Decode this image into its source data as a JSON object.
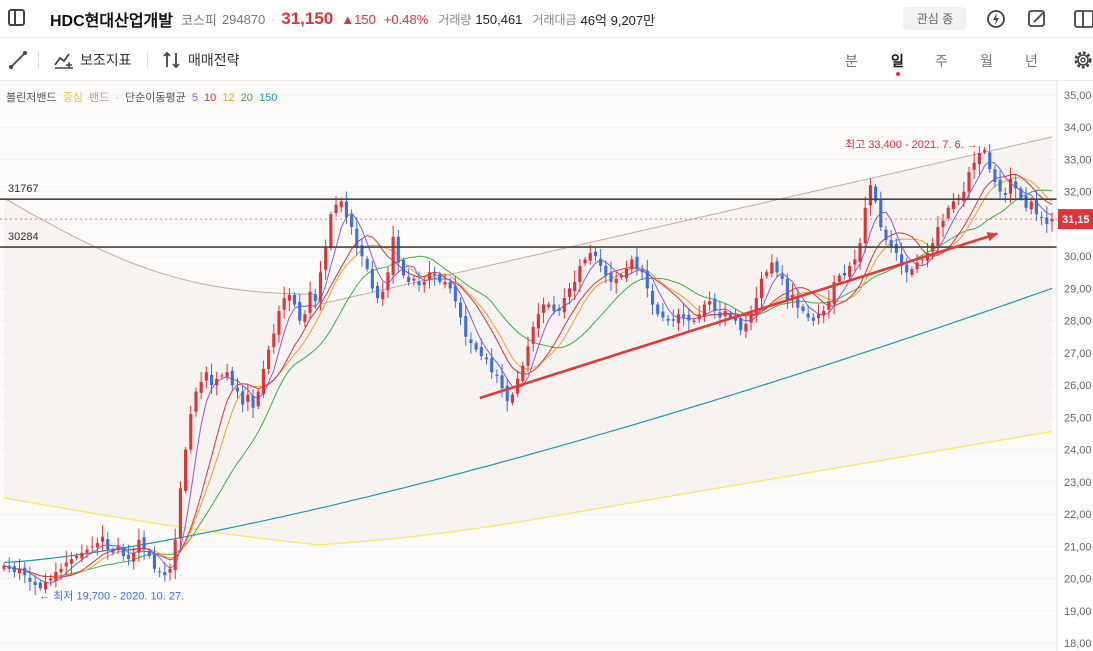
{
  "header": {
    "name": "HDC현대산업개발",
    "market": "코스피",
    "code": "294870",
    "price": "31,150",
    "change": "▲150",
    "change_pct": "+0.48%",
    "volume_label": "거래량",
    "volume": "150,461",
    "amount_label": "거래대금",
    "amount": "46억 9,207만",
    "watch_label": "관심 종"
  },
  "toolbar": {
    "indicator_label": "보조지표",
    "strategy_label": "매매전략",
    "periods": [
      "분",
      "일",
      "주",
      "월",
      "년"
    ],
    "active_period": "일"
  },
  "legend": {
    "bollinger": "볼린저밴드",
    "bollinger_center": "중심",
    "bollinger_band": "밴드",
    "sma_label": "단순이동평균",
    "sma_periods": [
      "5",
      "10",
      "12",
      "20",
      "150"
    ],
    "sma_colors": [
      "#8e5ad8",
      "#e0323b",
      "#f0a030",
      "#3fae49",
      "#1b9aaa"
    ]
  },
  "colors": {
    "up": "#e0323b",
    "down": "#3d6ee0",
    "bollinger_upper": "#c2aca4",
    "bollinger_center": "#f7e96a",
    "sma150": "#1b9aaa"
  },
  "chart_data": {
    "type": "candlestick",
    "y_axis": {
      "min": 18000,
      "max": 35000,
      "ticks": [
        "35,00",
        "34,00",
        "33,00",
        "32,00",
        "31,00",
        "30,00",
        "29,00",
        "28,00",
        "27,00",
        "26,00",
        "25,00",
        "24,00",
        "23,00",
        "22,00",
        "21,00",
        "20,00",
        "19,00",
        "18,00"
      ]
    },
    "current_price_label": "31,15",
    "current_price": 31150,
    "horizontal_lines": [
      {
        "label": "31767",
        "value": 31767
      },
      {
        "label": "30284",
        "value": 30284
      }
    ],
    "annotations": {
      "high": "최고 33,400 - 2021. 7. 6.",
      "low": "최저 19,700 - 2020. 10. 27."
    },
    "trend_line": {
      "from": [
        0.454,
        25600
      ],
      "to": [
        0.948,
        30700
      ]
    },
    "closes": [
      20400,
      20300,
      20200,
      20300,
      20100,
      19900,
      19800,
      19700,
      19900,
      20000,
      20200,
      20300,
      20500,
      20600,
      20700,
      20800,
      20900,
      21000,
      21100,
      21300,
      20900,
      20800,
      21000,
      20700,
      20600,
      20800,
      21200,
      20900,
      20700,
      20300,
      20200,
      20100,
      20300,
      21200,
      22800,
      24000,
      25100,
      25800,
      26100,
      26400,
      26000,
      26200,
      26300,
      26400,
      26000,
      25800,
      25400,
      25700,
      25300,
      25800,
      26500,
      27100,
      27600,
      28300,
      28700,
      28800,
      28500,
      28000,
      28200,
      28900,
      28600,
      29500,
      30300,
      31300,
      31600,
      31700,
      31200,
      30900,
      30300,
      30000,
      29600,
      29000,
      28700,
      28900,
      29500,
      30600,
      29800,
      29400,
      29200,
      29300,
      29100,
      29200,
      29500,
      29400,
      29200,
      29200,
      29000,
      28600,
      28100,
      27500,
      27300,
      27100,
      26900,
      26800,
      26400,
      26300,
      25900,
      25500,
      25700,
      26200,
      26600,
      27200,
      27800,
      28200,
      28500,
      28500,
      28300,
      28300,
      28700,
      29000,
      29200,
      29700,
      29900,
      30100,
      30000,
      29700,
      29400,
      29200,
      29300,
      29400,
      29600,
      29900,
      29600,
      29500,
      29000,
      28500,
      28200,
      28100,
      28000,
      28000,
      28200,
      28100,
      28000,
      28000,
      28200,
      28500,
      28600,
      28300,
      28100,
      28300,
      28100,
      28000,
      27700,
      27900,
      28300,
      28700,
      29300,
      29500,
      29800,
      29500,
      29300,
      28600,
      28800,
      28400,
      28300,
      28100,
      28000,
      28200,
      28300,
      28600,
      29200,
      29400,
      29400,
      29700,
      29900,
      30400,
      31500,
      32200,
      31700,
      30900,
      30500,
      30300,
      30100,
      29700,
      29500,
      29600,
      29800,
      29900,
      30100,
      30400,
      30900,
      31100,
      31500,
      31700,
      31800,
      32000,
      32600,
      32900,
      33200,
      33300,
      32700,
      32300,
      32000,
      31900,
      32400,
      32100,
      31800,
      31500,
      31700,
      31300,
      31200,
      31000,
      31150
    ]
  }
}
